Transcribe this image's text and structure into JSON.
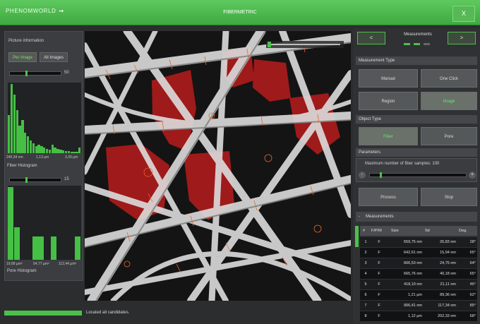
{
  "app": {
    "logo": "PHENOMWORLD",
    "logo_arrow": "➞",
    "title": "FIBERMETRIC",
    "close_label": "X",
    "accent": "#4cc04c"
  },
  "left": {
    "picture_info": "Picture information",
    "tab_per_image": "Per Image",
    "tab_all_images": "All Images",
    "fiber_slider_value": "50",
    "fiber_hist_min": "240,34 nm",
    "fiber_hist_mid": "1,13 µm",
    "fiber_hist_max": "3,39 µm",
    "fiber_hist_title": "Fiber Histogram",
    "fiber_hist_bins": [
      0.55,
      1.0,
      0.85,
      0.62,
      0.4,
      0.48,
      0.3,
      0.25,
      0.18,
      0.14,
      0.1,
      0.12,
      0.1,
      0.08,
      0.06,
      0.05,
      0.12,
      0.08,
      0.06,
      0.05,
      0.04,
      0.03,
      0.03,
      0.02,
      0.02,
      0.02,
      0.08
    ],
    "pore_slider_value": "15",
    "pore_hist_min": "19,68 µm²",
    "pore_hist_mid": "54,77 µm²",
    "pore_hist_max": "112,44 µm²",
    "pore_hist_title": "Pore Histogram",
    "pore_hist_bins": [
      1.0,
      0.45,
      0.0,
      0.0,
      0.32,
      0.32,
      0.0,
      0.32,
      0.0,
      0.0,
      0.0,
      0.32
    ]
  },
  "status": {
    "text": "Located all candidates."
  },
  "right": {
    "prev_label": "<",
    "next_label": ">",
    "measurements_label": "Measurements",
    "measurement_type_header": "Measurement Type",
    "btn_manual": "Manual",
    "btn_one_click": "One Click",
    "btn_region": "Region",
    "btn_image": "Image",
    "object_type_header": "Object Type",
    "btn_fiber": "Fiber",
    "btn_pore": "Pore",
    "parameters_header": "Parameters",
    "param_label": "Maximum number of fiber samples:",
    "param_value": "100",
    "param_minus": "-",
    "param_plus": "+",
    "btn_process": "Process",
    "btn_stop": "Stop",
    "table_header": "Measurements",
    "table_toggle": "-",
    "columns": [
      "#",
      "F/P/M",
      "Size",
      "Sd",
      "Deg."
    ],
    "rows": [
      [
        "1",
        "F",
        "659,75 nm",
        "26,83 nm",
        "28°"
      ],
      [
        "2",
        "F",
        "642,61 nm",
        "15,94 nm",
        "65°"
      ],
      [
        "3",
        "F",
        "666,53 nm",
        "24,75 nm",
        "64°"
      ],
      [
        "4",
        "F",
        "665,76 nm",
        "40,18 nm",
        "65°"
      ],
      [
        "5",
        "F",
        "418,19 nm",
        "21,11 nm",
        "46°"
      ],
      [
        "6",
        "F",
        "1,21 µm",
        "89,36 nm",
        "62°"
      ],
      [
        "7",
        "F",
        "906,41 nm",
        "117,34 nm",
        "85°"
      ],
      [
        "8",
        "F",
        "1,12 µm",
        "202,33 nm",
        "68°"
      ]
    ]
  }
}
